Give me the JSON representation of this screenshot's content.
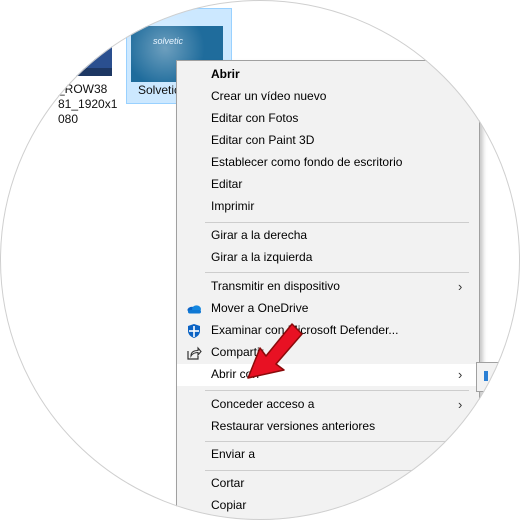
{
  "desktop": {
    "file1_label": "_ROW38\n81_1920x1\n080",
    "file2_label": "Solvetic",
    "file2_logo_text": "solvetic"
  },
  "context_menu": {
    "items": [
      {
        "label": "Abrir"
      },
      {
        "label": "Crear un vídeo nuevo"
      },
      {
        "label": "Editar con Fotos"
      },
      {
        "label": "Editar con Paint 3D"
      },
      {
        "label": "Establecer como fondo de escritorio"
      },
      {
        "label": "Editar"
      },
      {
        "label": "Imprimir"
      },
      {
        "label": "Girar a la derecha"
      },
      {
        "label": "Girar a la izquierda"
      },
      {
        "label": "Transmitir en dispositivo",
        "icon": "chevron-right-icon"
      },
      {
        "label": "Mover a OneDrive",
        "icon": "onedrive-icon"
      },
      {
        "label": "Examinar con Microsoft Defender...",
        "icon": "defender-shield-icon"
      },
      {
        "label": "Compartir",
        "icon": "share-icon"
      },
      {
        "label": "Abrir con",
        "icon": "chevron-right-icon"
      },
      {
        "label": "Conceder acceso a",
        "icon": "chevron-right-icon"
      },
      {
        "label": "Restaurar versiones anteriores"
      },
      {
        "label": "Enviar a"
      },
      {
        "label": "Cortar"
      },
      {
        "label": "Copiar"
      }
    ],
    "submenu_arrow": "›"
  },
  "colors": {
    "menu_bg": "#f2f2f2",
    "highlight": "#ffffff",
    "selection": "#cce8ff",
    "pointer": "#e81123",
    "onedrive": "#0a64c8"
  }
}
